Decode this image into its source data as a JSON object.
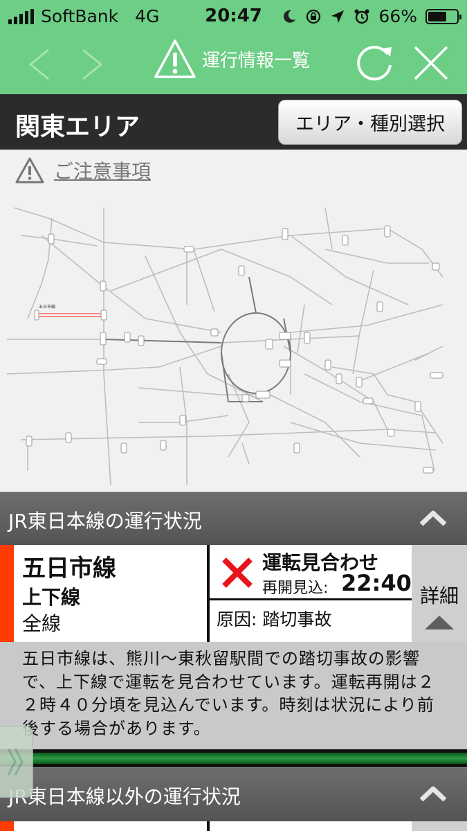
{
  "status_bar": {
    "carrier": "SoftBank",
    "network": "4G",
    "time": "20:47",
    "battery": "66%",
    "battery_level": 0.66
  },
  "nav": {
    "title": "運行情報一覧",
    "icons": [
      "back-icon",
      "forward-icon",
      "warning-icon",
      "refresh-icon",
      "close-icon"
    ]
  },
  "area": {
    "title": "関東エリア",
    "select_button": "エリア・種別選択"
  },
  "notice": {
    "link": "ご注意事項"
  },
  "map": {
    "highlight_label": "五日市線"
  },
  "jr_section": {
    "title": "JR東日本線の運行状況",
    "items": [
      {
        "line": "五日市線",
        "direction": "上下線",
        "range": "全線",
        "status": "運転見合わせ",
        "resume_label": "再開見込:",
        "resume_time": "22:40",
        "cause": "原因: 踏切事故",
        "detail_button": "詳細",
        "description": "五日市線は、熊川～東秋留駅間での踏切事故の影響で、上下線で運転を見合わせています。運転再開は２２時４０分頃を見込んでいます。時刻は状況により前後する場合があります。"
      }
    ]
  },
  "other_section": {
    "title": "JR東日本線以外の運行状況"
  },
  "colors": {
    "header_green": "#6dce85",
    "dark_bar": "#2b2b2b",
    "alert_red": "#ff3b00",
    "x_red": "#e8141c"
  }
}
